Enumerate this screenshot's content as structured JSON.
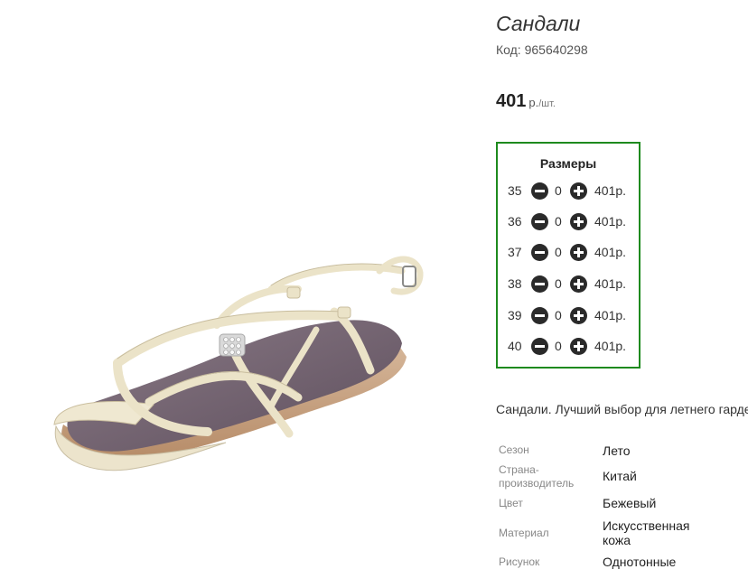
{
  "product": {
    "title": "Сандали",
    "code": "Код: 965640298",
    "price_value": "401",
    "price_unit": "р.",
    "price_per": "/шт.",
    "image_icon": "sandal-product-image"
  },
  "sizes": {
    "heading": "Размеры",
    "rows": [
      {
        "size": "35",
        "qty": "0",
        "price": "401р."
      },
      {
        "size": "36",
        "qty": "0",
        "price": "401р."
      },
      {
        "size": "37",
        "qty": "0",
        "price": "401р."
      },
      {
        "size": "38",
        "qty": "0",
        "price": "401р."
      },
      {
        "size": "39",
        "qty": "0",
        "price": "401р."
      },
      {
        "size": "40",
        "qty": "0",
        "price": "401р."
      }
    ]
  },
  "description": "Сандали. Лучший выбор для летнего гардероба",
  "attributes": [
    {
      "key": "Сезон",
      "value": "Лето"
    },
    {
      "key": "Страна-производитель",
      "value": "Китай"
    },
    {
      "key": "Цвет",
      "value": "Бежевый"
    },
    {
      "key": "Материал",
      "value": "Искусственная кожа"
    },
    {
      "key": "Рисунок",
      "value": "Однотонные"
    }
  ],
  "colors": {
    "sizes_border": "#1e8a1e",
    "button_fill": "#2a2a2a"
  }
}
